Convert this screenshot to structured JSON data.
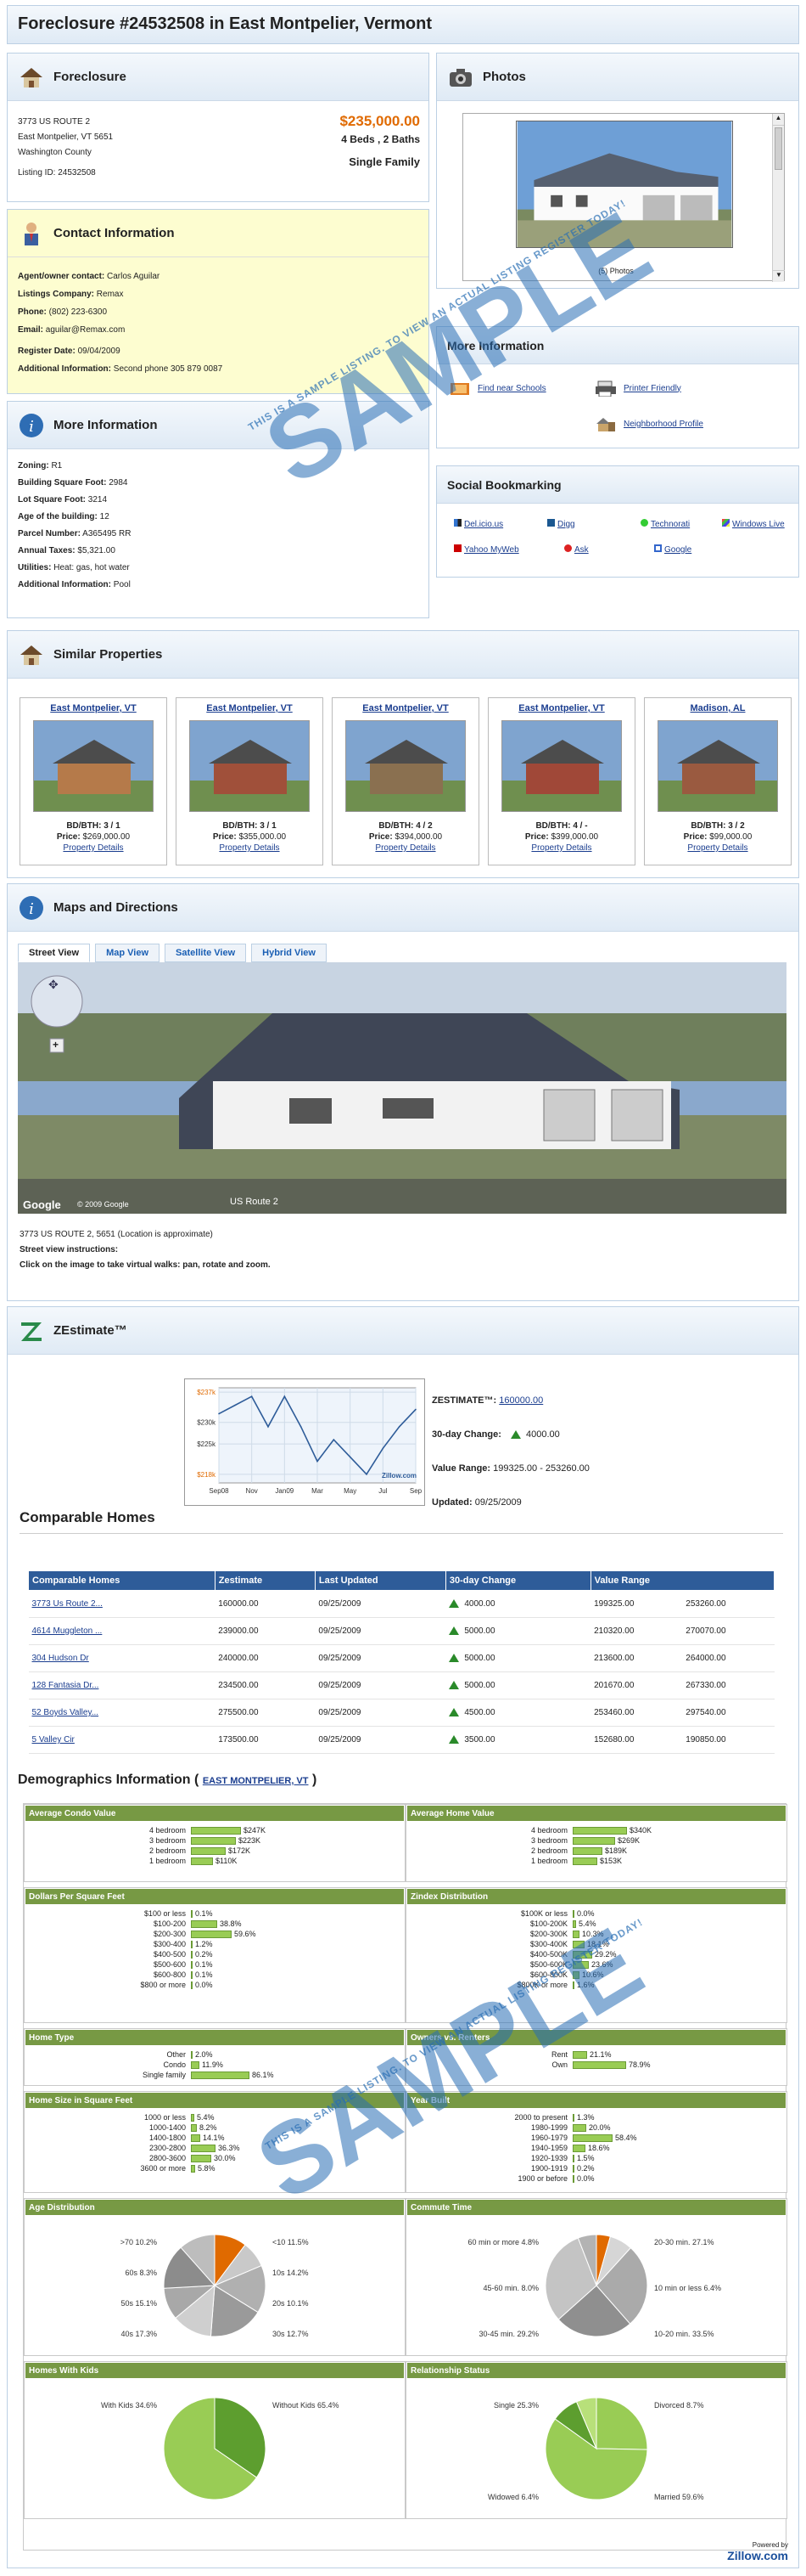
{
  "title": "Foreclosure #24532508 in East Montpelier, Vermont",
  "foreclosure": {
    "heading": "Foreclosure",
    "address1": "3773 US ROUTE 2",
    "address2": "East Montpelier, VT 5651",
    "county": "Washington County",
    "listing_id": "Listing ID: 24532508",
    "price": "$235,000.00",
    "beds_baths": "4 Beds , 2 Baths",
    "type": "Single Family"
  },
  "contact": {
    "heading": "Contact Information",
    "agent_label": "Agent/owner contact:",
    "agent": "Carlos Aguilar",
    "company_label": "Listings Company:",
    "company": "Remax",
    "phone_label": "Phone:",
    "phone": "(802) 223-6300",
    "email_label": "Email:",
    "email": "aguilar@Remax.com",
    "register_label": "Register Date:",
    "register": "09/04/2009",
    "additional_label": "Additional Information:",
    "additional": "Second phone 305 879 0087"
  },
  "more_info_left": {
    "heading": "More Information",
    "rows": [
      {
        "label": "Zoning:",
        "value": "R1"
      },
      {
        "label": "Building Square Foot:",
        "value": "2984"
      },
      {
        "label": "Lot Square Foot:",
        "value": "3214"
      },
      {
        "label": "Age of the building:",
        "value": "12"
      },
      {
        "label": "Parcel Number:",
        "value": "A365495 RR"
      },
      {
        "label": "Annual Taxes:",
        "value": "$5,321.00"
      },
      {
        "label": "Utilities:",
        "value": "Heat: gas, hot water"
      },
      {
        "label": "Additional Information:",
        "value": "Pool"
      }
    ]
  },
  "photos": {
    "heading": "Photos",
    "caption": "(5) Photos"
  },
  "more_info_right": {
    "heading": "More Information",
    "find_schools": "Find near Schools",
    "printer": "Printer Friendly",
    "neighborhood": "Neighborhood Profile"
  },
  "social": {
    "heading": "Social Bookmarking",
    "items": [
      "Del.icio.us",
      "Digg",
      "Technorati",
      "Windows Live",
      "Yahoo MyWeb",
      "Ask",
      "Google"
    ]
  },
  "similar": {
    "heading": "Similar Properties",
    "items": [
      {
        "city": "East Montpelier, VT",
        "bdbth": "BD/BTH: 3 / 1",
        "price_label": "Price:",
        "price": "$269,000.00",
        "link": "Property Details"
      },
      {
        "city": "East Montpelier, VT",
        "bdbth": "BD/BTH: 3 / 1",
        "price_label": "Price:",
        "price": "$355,000.00",
        "link": "Property Details"
      },
      {
        "city": "East Montpelier, VT",
        "bdbth": "BD/BTH: 4 / 2",
        "price_label": "Price:",
        "price": "$394,000.00",
        "link": "Property Details"
      },
      {
        "city": "East Montpelier, VT",
        "bdbth": "BD/BTH: 4 / -",
        "price_label": "Price:",
        "price": "$399,000.00",
        "link": "Property Details"
      },
      {
        "city": "Madison, AL",
        "bdbth": "BD/BTH: 3 / 2",
        "price_label": "Price:",
        "price": "$99,000.00",
        "link": "Property Details"
      }
    ]
  },
  "maps": {
    "heading": "Maps and Directions",
    "tabs": [
      "Street View",
      "Map View",
      "Satellite View",
      "Hybrid View"
    ],
    "road_label": "US Route 2",
    "copyright": "© 2009 Google",
    "google": "Google",
    "location": "3773 US ROUTE 2, 5651 (Location is approximate)",
    "instr_title": "Street view instructions:",
    "instr": "Click on the image to take virtual walks: pan, rotate and zoom."
  },
  "zestimate": {
    "heading": "ZEstimate™",
    "label": "ZESTIMATE™:",
    "value": "160000.00",
    "change_label": "30-day Change:",
    "change": "4000.00",
    "range_label": "Value Range:",
    "range": "199325.00 - 253260.00",
    "updated_label": "Updated:",
    "updated": "09/25/2009",
    "chart_brand": "Zillow.com"
  },
  "chart_data": {
    "type": "line",
    "x": [
      "Sep08",
      "Nov",
      "Jan09",
      "Mar",
      "May",
      "Jul",
      "Sep"
    ],
    "ytick_labels": [
      "$237k",
      "$230k",
      "$225k",
      "$218k"
    ],
    "values": [
      232,
      234,
      236,
      229,
      236,
      229,
      221,
      226,
      222,
      218,
      224,
      229,
      233
    ],
    "ylim": [
      216,
      238
    ],
    "title": "",
    "xlabel": "",
    "ylabel": "",
    "grid": true,
    "accent": "#2e5c99"
  },
  "comparable": {
    "heading": "Comparable Homes",
    "headers": [
      "Comparable Homes",
      "Zestimate",
      "Last Updated",
      "30-day Change",
      "Value Range"
    ],
    "rows": [
      {
        "name": "3773 Us Route 2...",
        "z": "160000.00",
        "u": "09/25/2009",
        "c": "4000.00",
        "lo": "199325.00",
        "hi": "253260.00"
      },
      {
        "name": "4614 Muggleton ...",
        "z": "239000.00",
        "u": "09/25/2009",
        "c": "5000.00",
        "lo": "210320.00",
        "hi": "270070.00"
      },
      {
        "name": "304 Hudson Dr",
        "z": "240000.00",
        "u": "09/25/2009",
        "c": "5000.00",
        "lo": "213600.00",
        "hi": "264000.00"
      },
      {
        "name": "128 Fantasia Dr...",
        "z": "234500.00",
        "u": "09/25/2009",
        "c": "5000.00",
        "lo": "201670.00",
        "hi": "267330.00"
      },
      {
        "name": "52 Boyds Valley...",
        "z": "275500.00",
        "u": "09/25/2009",
        "c": "4500.00",
        "lo": "253460.00",
        "hi": "297540.00"
      },
      {
        "name": "5 Valley Cir",
        "z": "173500.00",
        "u": "09/25/2009",
        "c": "3500.00",
        "lo": "152680.00",
        "hi": "190850.00"
      }
    ]
  },
  "demographics": {
    "heading": "Demographics Information (",
    "heading_end": ")",
    "link": "EAST MONTPELIER, VT",
    "avg_condo": {
      "title": "Average Condo Value",
      "rows": [
        {
          "l": "4 bedroom",
          "v": "$247K",
          "p": 0.74
        },
        {
          "l": "3 bedroom",
          "v": "$223K",
          "p": 0.66
        },
        {
          "l": "2 bedroom",
          "v": "$172K",
          "p": 0.51
        },
        {
          "l": "1 bedroom",
          "v": "$110K",
          "p": 0.33
        }
      ]
    },
    "avg_home": {
      "title": "Average Home Value",
      "rows": [
        {
          "l": "4 bedroom",
          "v": "$340K",
          "p": 0.8
        },
        {
          "l": "3 bedroom",
          "v": "$269K",
          "p": 0.63
        },
        {
          "l": "2 bedroom",
          "v": "$189K",
          "p": 0.44
        },
        {
          "l": "1 bedroom",
          "v": "$153K",
          "p": 0.36
        }
      ]
    },
    "dollars_sqft": {
      "title": "Dollars Per Square Feet",
      "rows": [
        {
          "l": "$100 or less",
          "v": "0.1%",
          "p": 0.001
        },
        {
          "l": "$100-200",
          "v": "38.8%",
          "p": 0.388
        },
        {
          "l": "$200-300",
          "v": "59.6%",
          "p": 0.596
        },
        {
          "l": "$300-400",
          "v": "1.2%",
          "p": 0.012
        },
        {
          "l": "$400-500",
          "v": "0.2%",
          "p": 0.002
        },
        {
          "l": "$500-600",
          "v": "0.1%",
          "p": 0.001
        },
        {
          "l": "$600-800",
          "v": "0.1%",
          "p": 0.001
        },
        {
          "l": "$800 or more",
          "v": "0.0%",
          "p": 0
        }
      ]
    },
    "zindex": {
      "title": "Zindex Distribution",
      "rows": [
        {
          "l": "$100K or less",
          "v": "0.0%",
          "p": 0
        },
        {
          "l": "$100-200K",
          "v": "5.4%",
          "p": 0.054
        },
        {
          "l": "$200-300K",
          "v": "10.3%",
          "p": 0.103
        },
        {
          "l": "$300-400K",
          "v": "18.1%",
          "p": 0.181
        },
        {
          "l": "$400-500K",
          "v": "29.2%",
          "p": 0.292
        },
        {
          "l": "$500-600K",
          "v": "23.6%",
          "p": 0.236
        },
        {
          "l": "$600-800K",
          "v": "10.6%",
          "p": 0.106
        },
        {
          "l": "$800K or more",
          "v": "1.6%",
          "p": 0.016
        }
      ]
    },
    "home_type": {
      "title": "Home Type",
      "rows": [
        {
          "l": "Other",
          "v": "2.0%",
          "p": 0.02
        },
        {
          "l": "Condo",
          "v": "11.9%",
          "p": 0.119
        },
        {
          "l": "Single family",
          "v": "86.1%",
          "p": 0.861
        }
      ]
    },
    "owners": {
      "title": "Owners vs. Renters",
      "rows": [
        {
          "l": "Rent",
          "v": "21.1%",
          "p": 0.211
        },
        {
          "l": "Own",
          "v": "78.9%",
          "p": 0.789
        }
      ]
    },
    "size": {
      "title": "Home Size in Square Feet",
      "rows": [
        {
          "l": "1000 or less",
          "v": "5.4%",
          "p": 0.054
        },
        {
          "l": "1000-1400",
          "v": "8.2%",
          "p": 0.082
        },
        {
          "l": "1400-1800",
          "v": "14.1%",
          "p": 0.141
        },
        {
          "l": "2300-2800",
          "v": "36.3%",
          "p": 0.363
        },
        {
          "l": "2800-3600",
          "v": "30.0%",
          "p": 0.3
        },
        {
          "l": "3600 or more",
          "v": "5.8%",
          "p": 0.058
        }
      ]
    },
    "year": {
      "title": "Year Built",
      "rows": [
        {
          "l": "2000 to present",
          "v": "1.3%",
          "p": 0.013
        },
        {
          "l": "1980-1999",
          "v": "20.0%",
          "p": 0.2
        },
        {
          "l": "1960-1979",
          "v": "58.4%",
          "p": 0.584
        },
        {
          "l": "1940-1959",
          "v": "18.6%",
          "p": 0.186
        },
        {
          "l": "1920-1939",
          "v": "1.5%",
          "p": 0.015
        },
        {
          "l": "1900-1919",
          "v": "0.2%",
          "p": 0.002
        },
        {
          "l": "1900 or before",
          "v": "0.0%",
          "p": 0
        }
      ]
    },
    "age": {
      "title": "Age Distribution",
      "labels": [
        ">70 10.2%",
        "60s 8.3%",
        "50s 15.1%",
        "40s 17.3%",
        "<10 11.5%",
        "10s 14.2%",
        "20s 10.1%",
        "30s 12.7%"
      ]
    },
    "commute": {
      "title": "Commute Time",
      "labels": [
        "60 min or more 4.8%",
        "45-60 min. 8.0%",
        "30-45 min. 29.2%",
        "20-30 min. 27.1%",
        "10 min or less 6.4%",
        "10-20 min. 33.5%"
      ]
    },
    "kids": {
      "title": "Homes With Kids",
      "labels": [
        "With Kids 34.6%",
        "Without Kids 65.4%"
      ]
    },
    "relationship": {
      "title": "Relationship Status",
      "labels": [
        "Single 25.3%",
        "Widowed 6.4%",
        "Divorced 8.7%",
        "Married 59.6%"
      ]
    }
  },
  "footer": {
    "powered": "Powered by",
    "brand": "Zillow.com"
  },
  "watermark": {
    "big": "SAMPLE",
    "small": "THIS IS A SAMPLE LISTING. TO VIEW AN ACTUAL LISTING REGISTER TODAY!"
  }
}
